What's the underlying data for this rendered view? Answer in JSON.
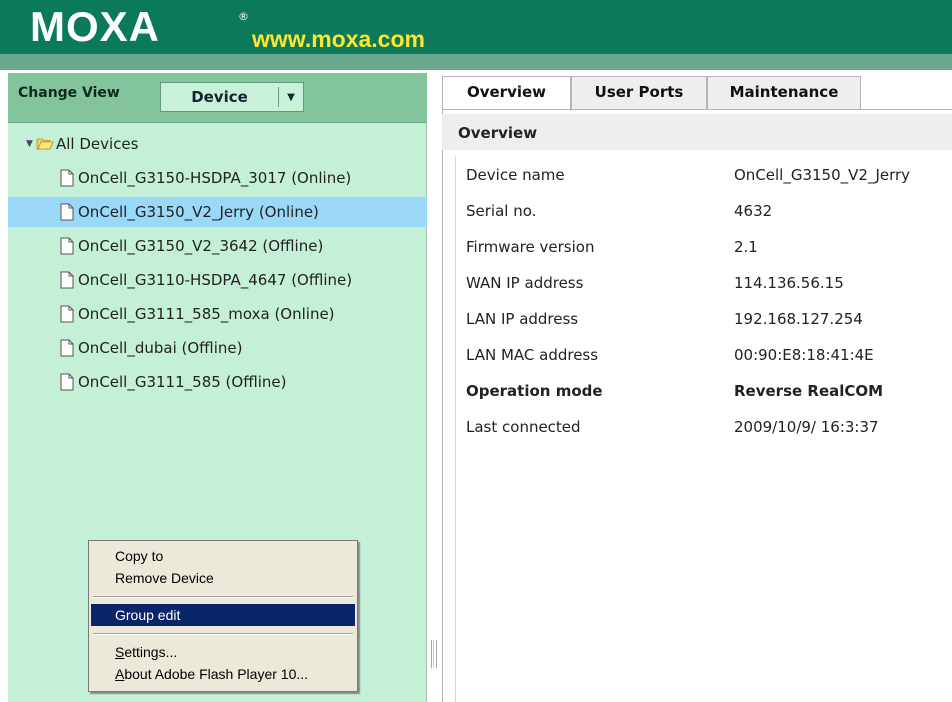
{
  "header": {
    "logo_text": "MOXA",
    "logo_reg": "®",
    "url": "www.moxa.com",
    "colors": {
      "bar": "#0b7a5a",
      "sub_bar": "#6ba88d",
      "url": "#ffe52e"
    }
  },
  "left_panel": {
    "change_view_label": "Change View",
    "view_dropdown": {
      "selected": "Device",
      "arrow_icon": "triangle-down-icon"
    },
    "tree": {
      "root_label": "All Devices",
      "items": [
        {
          "label": "OnCell_G3150-HSDPA_3017 (Online)",
          "selected": false
        },
        {
          "label": "OnCell_G3150_V2_Jerry (Online)",
          "selected": true
        },
        {
          "label": "OnCell_G3150_V2_3642 (Offline)",
          "selected": false
        },
        {
          "label": "OnCell_G3110-HSDPA_4647 (Offline)",
          "selected": false
        },
        {
          "label": "OnCell_G3111_585_moxa (Online)",
          "selected": false
        },
        {
          "label": "OnCell_dubai (Offline)",
          "selected": false
        },
        {
          "label": "OnCell_G3111_585 (Offline)",
          "selected": false
        }
      ]
    },
    "colors": {
      "background": "#c4f0d8",
      "toolbar": "#82c49c",
      "selected_row": "#9ad8f8"
    }
  },
  "context_menu": {
    "copy_to": "Copy to",
    "remove_device": "Remove Device",
    "group_edit": "Group edit",
    "settings_first": "S",
    "settings_rest": "ettings...",
    "about_first": "A",
    "about_rest": "bout Adobe Flash Player 10...",
    "highlight_color": "#0a246a"
  },
  "tabs": [
    {
      "label": "Overview",
      "active": true
    },
    {
      "label": "User Ports",
      "active": false
    },
    {
      "label": "Maintenance",
      "active": false
    }
  ],
  "overview": {
    "title": "Overview",
    "rows": [
      {
        "label": "Device name",
        "value": "OnCell_G3150_V2_Jerry",
        "bold": false
      },
      {
        "label": "Serial no.",
        "value": "4632",
        "bold": false
      },
      {
        "label": "Firmware version",
        "value": "2.1",
        "bold": false
      },
      {
        "label": "WAN IP address",
        "value": "114.136.56.15",
        "bold": false
      },
      {
        "label": "LAN IP address",
        "value": "192.168.127.254",
        "bold": false
      },
      {
        "label": "LAN MAC address",
        "value": "00:90:E8:18:41:4E",
        "bold": false
      },
      {
        "label": "Operation mode",
        "value": "Reverse RealCOM",
        "bold": true
      },
      {
        "label": "Last connected",
        "value": "2009/10/9/ 16:3:37",
        "bold": false
      }
    ]
  }
}
